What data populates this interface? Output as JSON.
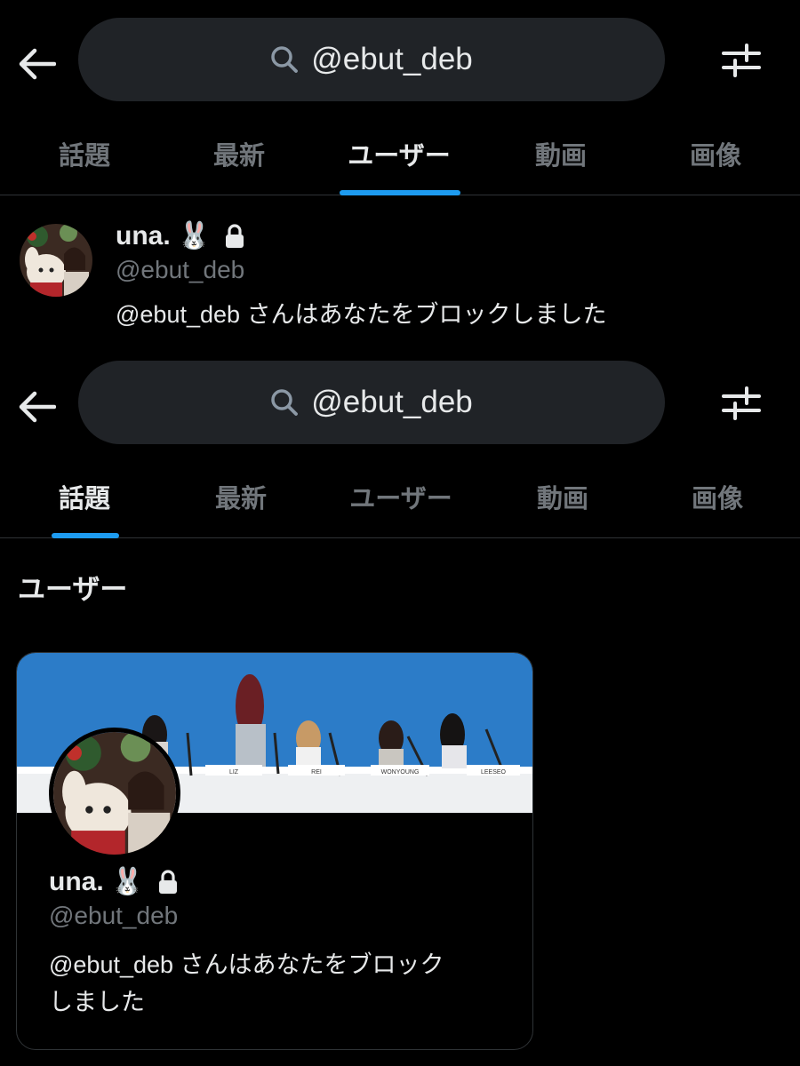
{
  "search": {
    "query": "@ebut_deb"
  },
  "tabs": [
    {
      "label": "話題"
    },
    {
      "label": "最新"
    },
    {
      "label": "ユーザー"
    },
    {
      "label": "動画"
    },
    {
      "label": "画像"
    }
  ],
  "user": {
    "name": "una.",
    "emoji": "🐰",
    "handle": "@ebut_deb",
    "blocked_message": "@ebut_deb さんはあなたをブロックしました",
    "blocked_message_line1": "@ebut_deb さんはあなたをブロック",
    "blocked_message_line2": "しました"
  },
  "section": {
    "users_title": "ユーザー"
  },
  "banner": {
    "nameplates": [
      "LIZ",
      "REI",
      "WONYOUNG",
      "LEESEO"
    ]
  },
  "colors": {
    "background": "#000000",
    "pill": "#202327",
    "accent": "#1d9bf0",
    "muted": "#71767b",
    "text": "#e7e9ea",
    "divider": "#2f3336"
  },
  "icons": {
    "back": "arrow-left-icon",
    "search": "search-icon",
    "filter": "sliders-icon",
    "lock": "lock-icon"
  }
}
